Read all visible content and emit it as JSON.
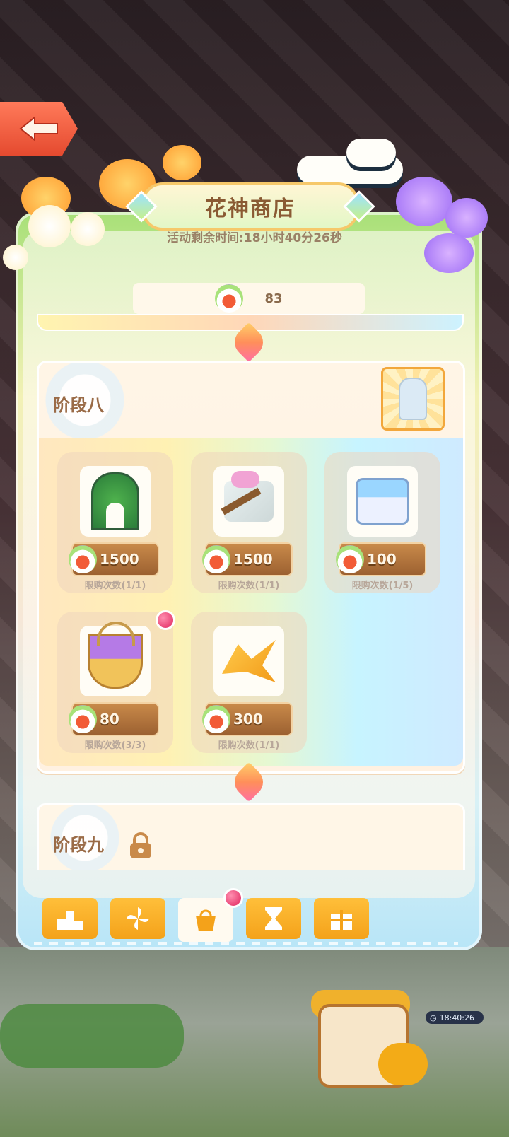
{
  "header": {
    "title": "花神商店",
    "countdown": "活动剩余时间:18小时40分26秒"
  },
  "currency": {
    "icon": "flower-token-icon",
    "value": "83"
  },
  "stage8": {
    "label": "阶段八",
    "reward_icon": "statue-reward-icon",
    "items": [
      {
        "name": "flower-arch",
        "icon": "flower-arch-icon",
        "price": "1500",
        "limit": "限购次数(1/1)"
      },
      {
        "name": "flower-ladder",
        "icon": "garden-ladder-icon",
        "price": "1500",
        "limit": "限购次数(1/1)"
      },
      {
        "name": "blue-flower-cake",
        "icon": "flower-cake-icon",
        "price": "100",
        "limit": "限购次数(1/5)"
      },
      {
        "name": "flower-basket",
        "icon": "flower-basket-icon",
        "price": "80",
        "limit": "限购次数(3/3)",
        "badge": true
      },
      {
        "name": "golden-wing",
        "icon": "golden-wing-icon",
        "price": "300",
        "limit": "限购次数(1/1)"
      }
    ]
  },
  "stage9": {
    "label": "阶段九",
    "locked": true
  },
  "tabs": [
    {
      "name": "ranking",
      "icon": "podium-icon",
      "active": false
    },
    {
      "name": "pinwheel",
      "icon": "pinwheel-icon",
      "active": false
    },
    {
      "name": "shop",
      "icon": "shop-bag-icon",
      "active": true,
      "badge": true
    },
    {
      "name": "hourglass",
      "icon": "hourglass-icon",
      "active": false
    },
    {
      "name": "gift",
      "icon": "gift-icon",
      "active": false
    }
  ],
  "game_clock": "18:40:26",
  "colors": {
    "accent_orange": "#f4a21a",
    "price_brown": "#9c6131",
    "title_brown": "#8a5a33",
    "badge_red": "#e0245d"
  }
}
